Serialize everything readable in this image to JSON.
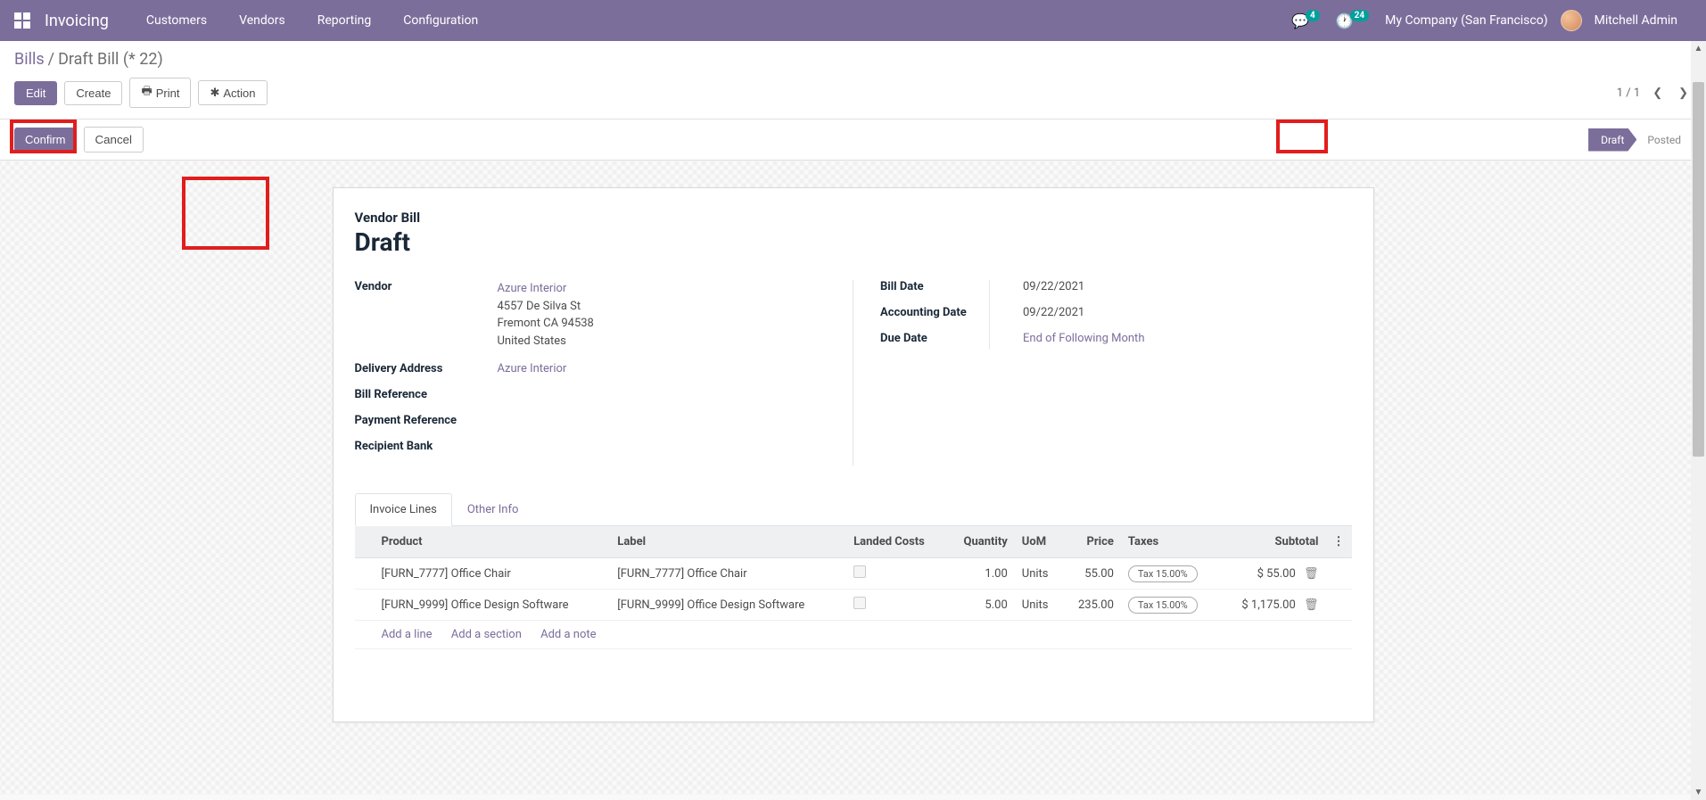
{
  "navbar": {
    "brand": "Invoicing",
    "menu": [
      "Customers",
      "Vendors",
      "Reporting",
      "Configuration"
    ],
    "chat_badge": "4",
    "activity_badge": "24",
    "company": "My Company (San Francisco)",
    "user": "Mitchell Admin"
  },
  "breadcrumb": {
    "root": "Bills",
    "current": "Draft Bill (* 22)"
  },
  "buttons": {
    "edit": "Edit",
    "create": "Create",
    "print": "Print",
    "action": "Action",
    "confirm": "Confirm",
    "cancel": "Cancel"
  },
  "pager": {
    "text": "1 / 1"
  },
  "status": {
    "draft": "Draft",
    "posted": "Posted"
  },
  "title": {
    "label": "Vendor Bill",
    "state": "Draft"
  },
  "left_fields": {
    "vendor_label": "Vendor",
    "vendor_name": "Azure Interior",
    "vendor_addr1": "4557 De Silva St",
    "vendor_addr2": "Fremont CA 94538",
    "vendor_addr3": "United States",
    "delivery_label": "Delivery Address",
    "delivery_value": "Azure Interior",
    "billref_label": "Bill Reference",
    "payref_label": "Payment Reference",
    "bank_label": "Recipient Bank"
  },
  "right_fields": {
    "billdate_label": "Bill Date",
    "billdate_value": "09/22/2021",
    "acctdate_label": "Accounting Date",
    "acctdate_value": "09/22/2021",
    "duedate_label": "Due Date",
    "duedate_value": "End of Following Month"
  },
  "tabs": {
    "invoice_lines": "Invoice Lines",
    "other_info": "Other Info"
  },
  "table": {
    "headers": {
      "product": "Product",
      "label": "Label",
      "landed": "Landed Costs",
      "qty": "Quantity",
      "uom": "UoM",
      "price": "Price",
      "taxes": "Taxes",
      "subtotal": "Subtotal"
    },
    "rows": [
      {
        "product": "[FURN_7777] Office Chair",
        "label": "[FURN_7777] Office Chair",
        "qty": "1.00",
        "uom": "Units",
        "price": "55.00",
        "tax": "Tax 15.00%",
        "subtotal": "$ 55.00"
      },
      {
        "product": "[FURN_9999] Office Design Software",
        "label": "[FURN_9999] Office Design Software",
        "qty": "5.00",
        "uom": "Units",
        "price": "235.00",
        "tax": "Tax 15.00%",
        "subtotal": "$ 1,175.00"
      }
    ],
    "add_line": "Add a line",
    "add_section": "Add a section",
    "add_note": "Add a note"
  }
}
